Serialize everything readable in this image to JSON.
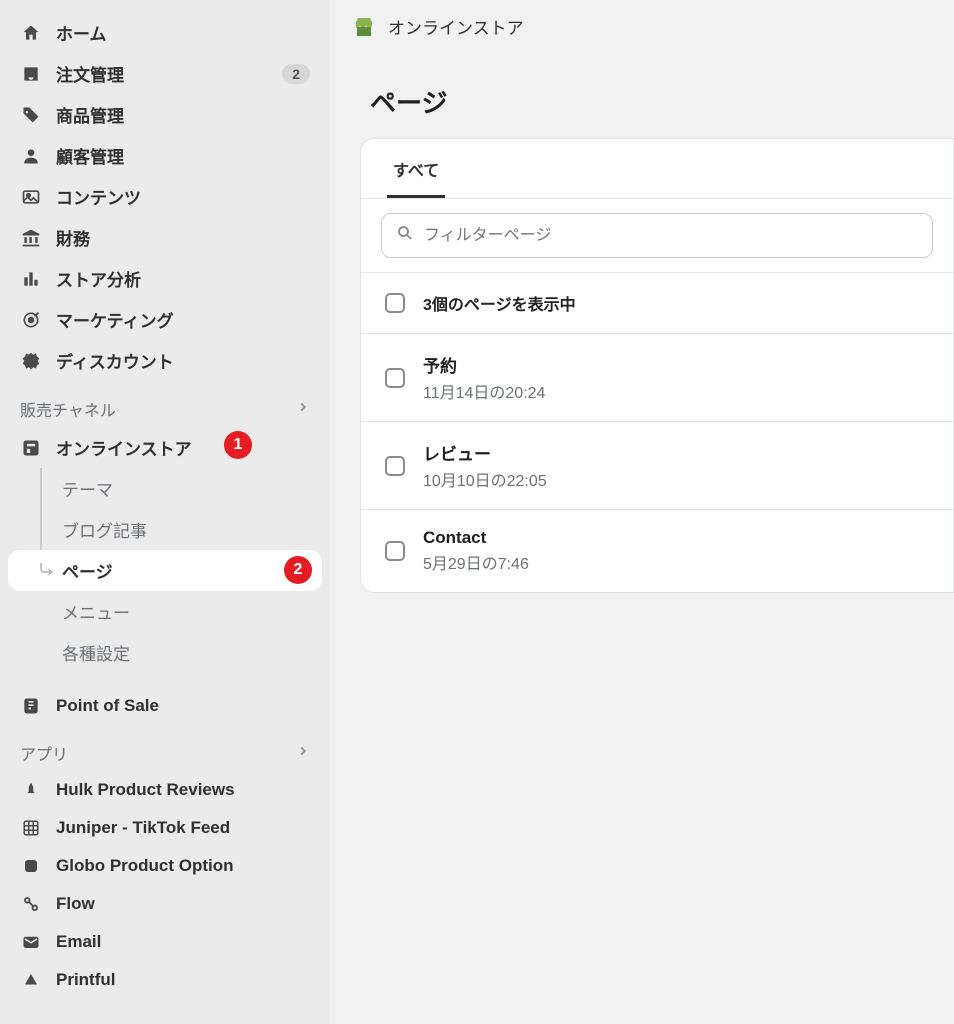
{
  "sidebar": {
    "items": [
      {
        "label": "ホーム",
        "icon": "home"
      },
      {
        "label": "注文管理",
        "icon": "inbox",
        "badge": "2"
      },
      {
        "label": "商品管理",
        "icon": "tag"
      },
      {
        "label": "顧客管理",
        "icon": "person"
      },
      {
        "label": "コンテンツ",
        "icon": "image"
      },
      {
        "label": "財務",
        "icon": "bank"
      },
      {
        "label": "ストア分析",
        "icon": "bars"
      },
      {
        "label": "マーケティング",
        "icon": "target"
      },
      {
        "label": "ディスカウント",
        "icon": "discount"
      }
    ],
    "channels_header": "販売チャネル",
    "online_store": {
      "label": "オンラインストア",
      "marker": "1"
    },
    "online_sub": [
      {
        "label": "テーマ"
      },
      {
        "label": "ブログ記事"
      },
      {
        "label": "ページ",
        "active": true,
        "marker": "2"
      },
      {
        "label": "メニュー"
      },
      {
        "label": "各種設定"
      }
    ],
    "pos": {
      "label": "Point of Sale"
    },
    "apps_header": "アプリ",
    "apps": [
      {
        "label": "Hulk Product Reviews"
      },
      {
        "label": "Juniper - TikTok Feed"
      },
      {
        "label": "Globo Product Option"
      },
      {
        "label": "Flow"
      },
      {
        "label": "Email"
      },
      {
        "label": "Printful"
      }
    ]
  },
  "header": {
    "label": "オンラインストア"
  },
  "page": {
    "title": "ページ"
  },
  "tabs": {
    "all": "すべて"
  },
  "filter": {
    "placeholder": "フィルターページ"
  },
  "summary": {
    "text": "3個のページを表示中"
  },
  "rows": [
    {
      "title": "予約",
      "sub": "11月14日の20:24"
    },
    {
      "title": "レビュー",
      "sub": "10月10日の22:05"
    },
    {
      "title": "Contact",
      "sub": "5月29日の7:46"
    }
  ]
}
